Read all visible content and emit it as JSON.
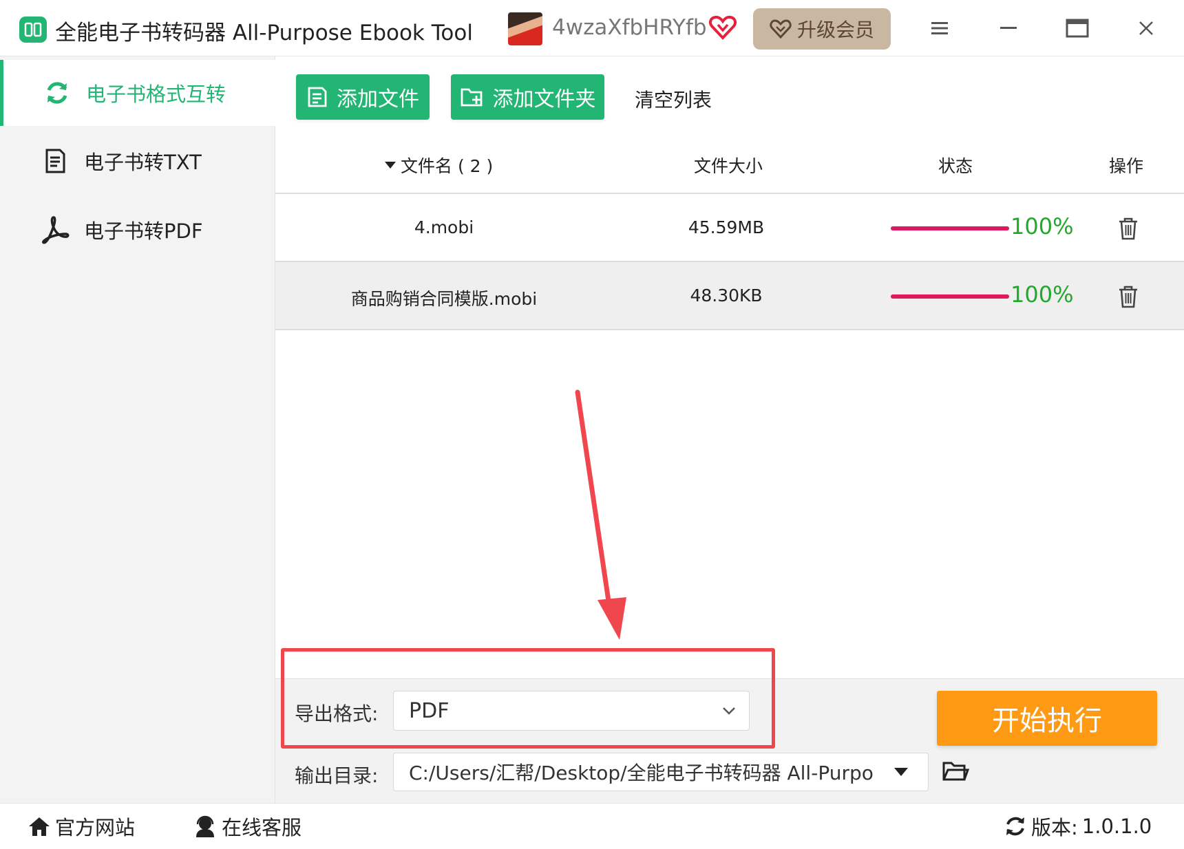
{
  "window": {
    "title": "全能电子书转码器 All-Purpose Ebook Tool",
    "username": "4wzaXfbHRYfb",
    "upgrade_label": "升级会员"
  },
  "sidebar": {
    "items": [
      {
        "label": "电子书格式互转",
        "icon": "refresh-icon",
        "active": true
      },
      {
        "label": "电子书转TXT",
        "icon": "document-icon",
        "active": false
      },
      {
        "label": "电子书转PDF",
        "icon": "pdf-icon",
        "active": false
      }
    ]
  },
  "toolbar": {
    "add_file_label": "添加文件",
    "add_folder_label": "添加文件夹",
    "clear_label": "清空列表"
  },
  "table": {
    "headers": {
      "name": "文件名 ( 2 )",
      "size": "文件大小",
      "status": "状态",
      "action": "操作"
    },
    "rows": [
      {
        "name": "4.mobi",
        "size": "45.59MB",
        "progress": "100%"
      },
      {
        "name": "商品购销合同模版.mobi",
        "size": "48.30KB",
        "progress": "100%"
      }
    ]
  },
  "output": {
    "format_label": "导出格式:",
    "format_value": "PDF",
    "dir_label": "输出目录:",
    "dir_value": "C:/Users/汇帮/Desktop/全能电子书转码器 All-Purpo",
    "start_label": "开始执行"
  },
  "statusbar": {
    "website_label": "官方网站",
    "support_label": "在线客服",
    "version_label": "版本:",
    "version_value": "1.0.1.0"
  },
  "colors": {
    "brand_green": "#22b573",
    "progress_pink": "#e0185f",
    "percent_green": "#22a82c",
    "start_orange": "#ff9a14",
    "highlight_red": "#f0474f"
  }
}
